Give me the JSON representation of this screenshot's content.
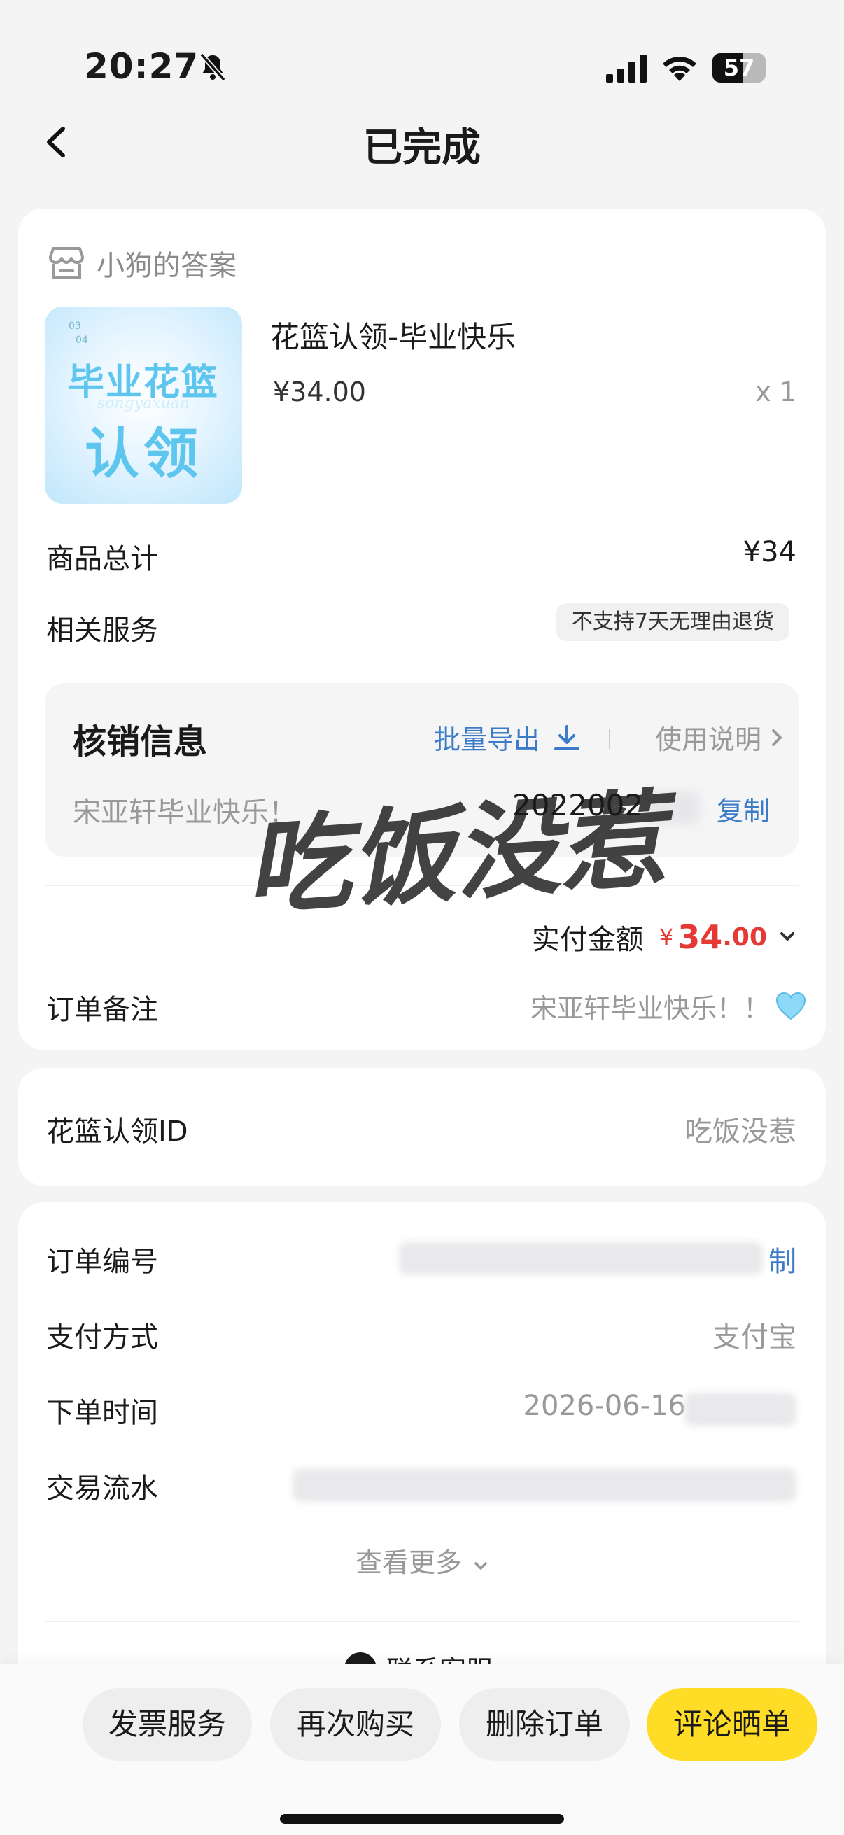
{
  "status_bar": {
    "time": "20:27",
    "battery": "57",
    "battery_level": 0.57
  },
  "header": {
    "title": "已完成"
  },
  "order": {
    "shop_name": "小狗的答案",
    "product": {
      "title": "花篮认领-毕业快乐",
      "price": "¥34.00",
      "qty": "x 1",
      "image_text_1": "毕业花篮",
      "image_text_2": "认领",
      "image_text_script": "songyaxuan",
      "image_num_1": "03",
      "image_num_2": "04"
    },
    "total_label": "商品总计",
    "total_value": "¥34",
    "service_label": "相关服务",
    "service_value": "不支持7天无理由退货",
    "verify": {
      "title": "核销信息",
      "batch_export": "批量导出",
      "usage": "使用说明",
      "name": "宋亚轩毕业快乐！",
      "code": "2022002",
      "copy": "复制"
    },
    "watermark": "吃饭没惹",
    "paid_label": "实付金额",
    "paid_symbol": "¥",
    "paid_int": "34",
    "paid_dec": ".00",
    "remark_label": "订单备注",
    "remark_value": "宋亚轩毕业快乐！！"
  },
  "claim": {
    "label": "花篮认领ID",
    "value": "吃饭没惹"
  },
  "details": {
    "order_no_label": "订单编号",
    "order_no_copy": "制",
    "pay_method_label": "支付方式",
    "pay_method_value": "支付宝",
    "order_time_label": "下单时间",
    "order_time_value": "2026-06-16",
    "trade_label": "交易流水",
    "see_more": "查看更多",
    "contact": "联系客服"
  },
  "actions": {
    "invoice": "发票服务",
    "rebuy": "再次购买",
    "delete": "删除订单",
    "review": "评论晒单"
  },
  "colors": {
    "accent_blue": "#3b7bc7",
    "price_red": "#e53935",
    "primary_yellow": "#ffdc26"
  }
}
